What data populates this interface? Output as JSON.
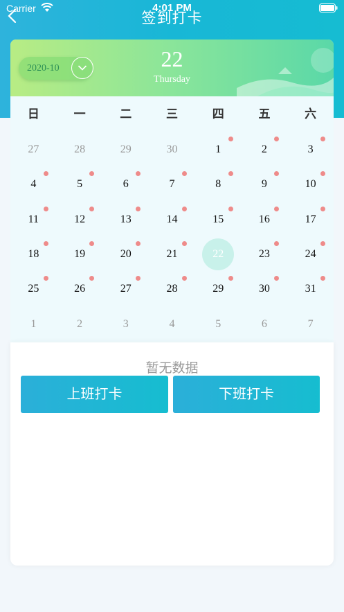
{
  "status_bar": {
    "carrier": "Carrier",
    "time": "4:01 PM"
  },
  "nav": {
    "title": "签到打卡"
  },
  "calendar": {
    "month": "2020-10",
    "day": "22",
    "weekday": "Thursday",
    "weekday_headers": [
      "日",
      "一",
      "二",
      "三",
      "四",
      "五",
      "六"
    ],
    "cells": [
      {
        "d": "27",
        "muted": true,
        "dot": false,
        "today": false
      },
      {
        "d": "28",
        "muted": true,
        "dot": false,
        "today": false
      },
      {
        "d": "29",
        "muted": true,
        "dot": false,
        "today": false
      },
      {
        "d": "30",
        "muted": true,
        "dot": false,
        "today": false
      },
      {
        "d": "1",
        "muted": false,
        "dot": true,
        "today": false
      },
      {
        "d": "2",
        "muted": false,
        "dot": true,
        "today": false
      },
      {
        "d": "3",
        "muted": false,
        "dot": true,
        "today": false
      },
      {
        "d": "4",
        "muted": false,
        "dot": true,
        "today": false
      },
      {
        "d": "5",
        "muted": false,
        "dot": true,
        "today": false
      },
      {
        "d": "6",
        "muted": false,
        "dot": true,
        "today": false
      },
      {
        "d": "7",
        "muted": false,
        "dot": true,
        "today": false
      },
      {
        "d": "8",
        "muted": false,
        "dot": true,
        "today": false
      },
      {
        "d": "9",
        "muted": false,
        "dot": true,
        "today": false
      },
      {
        "d": "10",
        "muted": false,
        "dot": true,
        "today": false
      },
      {
        "d": "11",
        "muted": false,
        "dot": true,
        "today": false
      },
      {
        "d": "12",
        "muted": false,
        "dot": true,
        "today": false
      },
      {
        "d": "13",
        "muted": false,
        "dot": true,
        "today": false
      },
      {
        "d": "14",
        "muted": false,
        "dot": true,
        "today": false
      },
      {
        "d": "15",
        "muted": false,
        "dot": true,
        "today": false
      },
      {
        "d": "16",
        "muted": false,
        "dot": true,
        "today": false
      },
      {
        "d": "17",
        "muted": false,
        "dot": true,
        "today": false
      },
      {
        "d": "18",
        "muted": false,
        "dot": true,
        "today": false
      },
      {
        "d": "19",
        "muted": false,
        "dot": true,
        "today": false
      },
      {
        "d": "20",
        "muted": false,
        "dot": true,
        "today": false
      },
      {
        "d": "21",
        "muted": false,
        "dot": true,
        "today": false
      },
      {
        "d": "22",
        "muted": false,
        "dot": false,
        "today": true
      },
      {
        "d": "23",
        "muted": false,
        "dot": true,
        "today": false
      },
      {
        "d": "24",
        "muted": false,
        "dot": true,
        "today": false
      },
      {
        "d": "25",
        "muted": false,
        "dot": true,
        "today": false
      },
      {
        "d": "26",
        "muted": false,
        "dot": true,
        "today": false
      },
      {
        "d": "27",
        "muted": false,
        "dot": true,
        "today": false
      },
      {
        "d": "28",
        "muted": false,
        "dot": true,
        "today": false
      },
      {
        "d": "29",
        "muted": false,
        "dot": true,
        "today": false
      },
      {
        "d": "30",
        "muted": false,
        "dot": true,
        "today": false
      },
      {
        "d": "31",
        "muted": false,
        "dot": true,
        "today": false
      },
      {
        "d": "1",
        "muted": true,
        "dot": false,
        "today": false
      },
      {
        "d": "2",
        "muted": true,
        "dot": false,
        "today": false
      },
      {
        "d": "3",
        "muted": true,
        "dot": false,
        "today": false
      },
      {
        "d": "4",
        "muted": true,
        "dot": false,
        "today": false
      },
      {
        "d": "5",
        "muted": true,
        "dot": false,
        "today": false
      },
      {
        "d": "6",
        "muted": true,
        "dot": false,
        "today": false
      },
      {
        "d": "7",
        "muted": true,
        "dot": false,
        "today": false
      }
    ]
  },
  "records": {
    "empty_text": "暂无数据"
  },
  "actions": {
    "clock_in": "上班打卡",
    "clock_out": "下班打卡"
  },
  "icons": {
    "wifi": "wifi-icon",
    "battery": "battery-icon",
    "back": "chevron-left-icon",
    "toggle": "chevron-down-icon"
  },
  "colors": {
    "header": "#1eb5d8",
    "calendar_head_start": "#b8ec84",
    "calendar_head_end": "#5ad8a8",
    "dot": "#ee8b8a",
    "today_circle": "#c8f1ea",
    "button": "#1eb5d8"
  }
}
